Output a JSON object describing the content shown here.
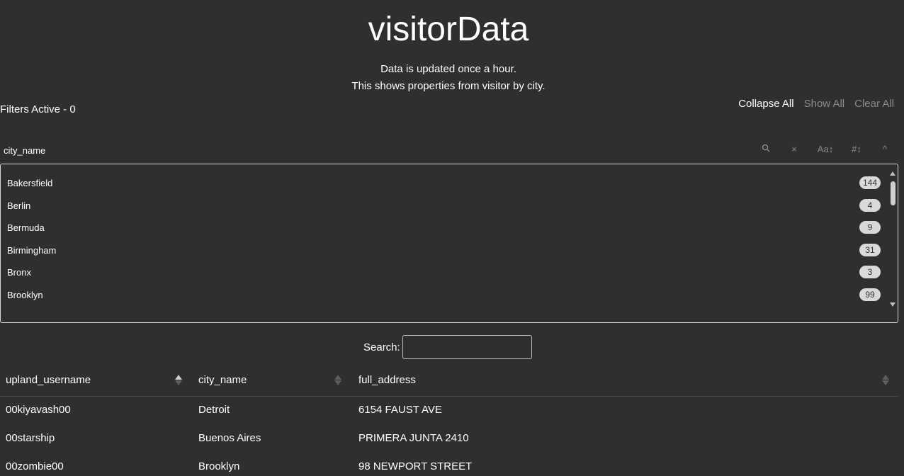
{
  "header": {
    "title": "visitorData",
    "subtitle_line1": "Data is updated once a hour.",
    "subtitle_line2": "This shows properties from visitor by city."
  },
  "filters": {
    "active_label": "Filters Active - 0",
    "collapse_all": "Collapse All",
    "show_all": "Show All",
    "clear_all": "Clear All"
  },
  "pane": {
    "title": "city_name",
    "tools": {
      "search_icon": "magnifier",
      "clear_icon": "×",
      "sort_alpha_icon": "Aa↕",
      "sort_num_icon": "#↕",
      "collapse_icon": "^"
    },
    "items": [
      {
        "city": "Bakersfield",
        "count": "144"
      },
      {
        "city": "Berlin",
        "count": "4"
      },
      {
        "city": "Bermuda",
        "count": "9"
      },
      {
        "city": "Birmingham",
        "count": "31"
      },
      {
        "city": "Bronx",
        "count": "3"
      },
      {
        "city": "Brooklyn",
        "count": "99"
      }
    ]
  },
  "search": {
    "label": "Search:",
    "value": ""
  },
  "table": {
    "columns": [
      "upland_username",
      "city_name",
      "full_address"
    ],
    "rows": [
      [
        "00kiyavash00",
        "Detroit",
        "6154 FAUST AVE"
      ],
      [
        "00starship",
        "Buenos Aires",
        "PRIMERA JUNTA 2410"
      ],
      [
        "00zombie00",
        "Brooklyn",
        "98 NEWPORT STREET"
      ]
    ]
  },
  "colors": {
    "background": "#2f2f2f",
    "text": "#ffffff",
    "muted": "#8a8a8a",
    "badge": "#d9d9d9"
  }
}
